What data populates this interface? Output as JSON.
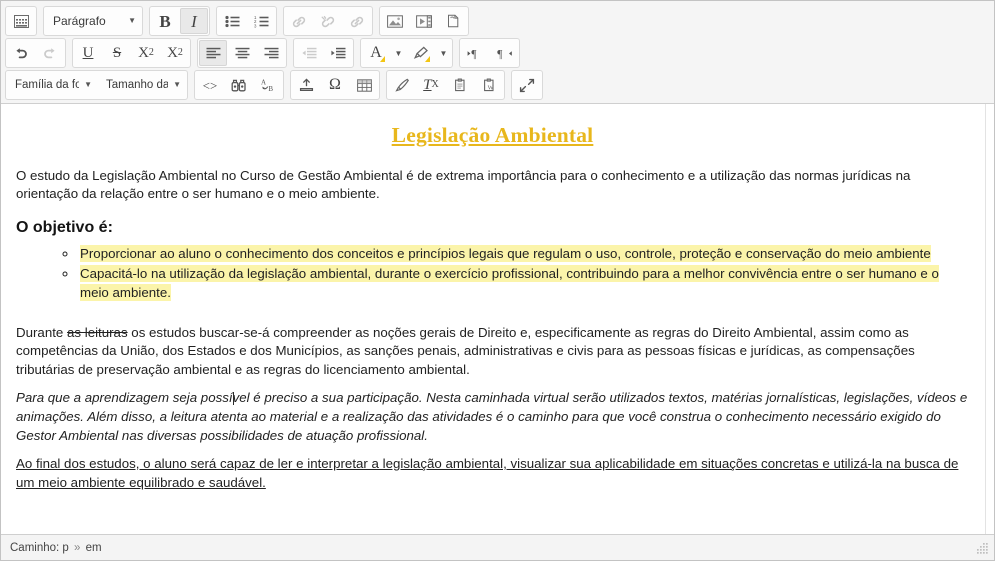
{
  "toolbar": {
    "row1": {
      "grid_icon_title": "insert-layout-grid",
      "paragraph_select": "Parágrafo",
      "bold_label": "B",
      "italic_label": "I",
      "bullet_list_title": "unordered-list",
      "number_list_title": "ordered-list",
      "link_title": "link",
      "unlink_title": "unlink",
      "anchor_title": "anchor",
      "image_title": "image",
      "media_title": "media",
      "file_title": "file"
    },
    "row2": {
      "undo_title": "undo",
      "redo_title": "redo",
      "underline_label": "U",
      "strike_label": "S",
      "subscript_label": "X",
      "subscript_index": "2",
      "superscript_label": "X",
      "superscript_index": "2",
      "align_left_title": "align-left",
      "align_center_title": "align-center",
      "align_right_title": "align-right",
      "outdent_title": "outdent",
      "indent_title": "indent",
      "text_color_label": "A",
      "highlight_color_title": "highlight-color",
      "ltr_title": "direction-ltr",
      "rtl_title": "direction-rtl",
      "color_swatch": "#f3c613"
    },
    "row3": {
      "font_family_select": "Família da fon",
      "font_size_select": "Tamanho da fo",
      "source_code_label": "<>",
      "find_title": "find",
      "replace_label_a": "A",
      "replace_label_b": "B",
      "insert_title": "insert-upload",
      "special_char_label": "Ω",
      "table_title": "table",
      "format_painter_title": "format-painter",
      "clear_format_label": "T",
      "clear_format_index": "X",
      "paste_title": "paste",
      "paste_word_title": "paste-from-word",
      "fullscreen_title": "fullscreen"
    }
  },
  "document": {
    "title": "Legislação Ambiental",
    "title_color": "#e8b71c",
    "intro": "O estudo da Legislação Ambiental no Curso de Gestão Ambiental é de extrema importância para o conhecimento e a utilização das normas jurídicas na orientação da relação entre o ser humano e o meio ambiente.",
    "objective_heading": "O objetivo é:",
    "objectives": [
      "Proporcionar ao aluno o conhecimento dos conceitos e princípios legais que regulam o uso, controle, proteção e conservação do meio ambiente",
      "Capacitá-lo na utilização da legislação ambiental, durante o exercício profissional, contribuindo para a melhor convivência entre o ser humano e o meio ambiente."
    ],
    "highlight_color": "#fbf4aa",
    "body_paragraph": {
      "lead": "Durante ",
      "struck": "as leituras",
      "rest": " os estudos buscar-se-á compreender as noções gerais de Direito e, especificamente as regras do Direito Ambiental, assim como as competências da União, dos Estados e dos Municípios, as sanções penais, administrativas e civis para as pessoas físicas e jurídicas, as compensações tributárias de preservação ambiental e as regras do licenciamento ambiental."
    },
    "italic_paragraph": {
      "before_caret": "Para que a aprendizagem seja possí",
      "after_caret": "vel é preciso a sua participação. Nesta caminhada virtual serão utilizados textos, matérias jornalísticas, legislações, vídeos e animações. Além disso, a leitura atenta ao material e a realização das atividades é o caminho para que você construa o conhecimento necessário exigido do Gestor Ambiental nas diversas possibilidades de atuação profissional."
    },
    "closing_paragraph": "Ao final dos estudos, o aluno será capaz de ler e interpretar a legislação ambiental, visualizar sua aplicabilidade em situações concretas e utilizá-la na busca de um meio ambiente equilibrado e saudável."
  },
  "statusbar": {
    "path_label": "Caminho:",
    "path_nodes": [
      "p",
      "em"
    ],
    "path_separator": "»",
    "resize_grip_title": "resize-handle"
  }
}
